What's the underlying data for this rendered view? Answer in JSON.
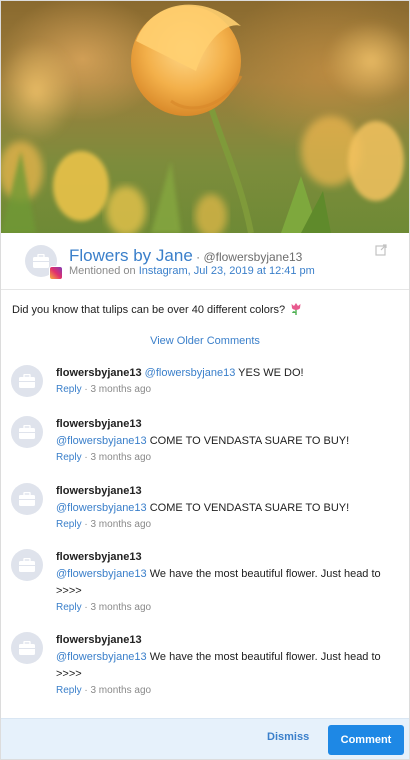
{
  "hero_image": {
    "subject": "tulip-photo",
    "colors": {
      "petal": "#f3b04a",
      "stem": "#7f9a3a"
    }
  },
  "post": {
    "page_name": "Flowers by Jane",
    "separator": " · ",
    "handle": "@flowersbyjane13",
    "mentioned_prefix": "Mentioned on ",
    "network": "Instagram",
    "date": ", Jul 23, 2019 at 12:41 pm",
    "text": "Did you know that tulips can be over 40 different colors?",
    "emoji_icon": "tulip-emoji"
  },
  "view_older_label": "View Older Comments",
  "comments": [
    {
      "user": "flowersbyjane13",
      "mention": "@flowersbyjane13",
      "text": " YES WE DO!",
      "reply": "Reply",
      "time": " · 3 months ago"
    },
    {
      "user": "flowersbyjane13",
      "mention": "@flowersbyjane13",
      "text": " COME TO VENDASTA SUARE TO BUY!",
      "reply": "Reply",
      "time": " · 3 months ago"
    },
    {
      "user": "flowersbyjane13",
      "mention": "@flowersbyjane13",
      "text": " COME TO VENDASTA SUARE TO BUY!",
      "reply": "Reply",
      "time": " · 3 months ago"
    },
    {
      "user": "flowersbyjane13",
      "mention": "@flowersbyjane13",
      "text": " We have the most beautiful flower. Just head to >>>>",
      "reply": "Reply",
      "time": " · 3 months ago"
    },
    {
      "user": "flowersbyjane13",
      "mention": "@flowersbyjane13",
      "text": " We have the most beautiful flower. Just head to >>>>",
      "reply": "Reply",
      "time": " · 3 months ago"
    }
  ],
  "footer": {
    "dismiss_label": "Dismiss",
    "comment_label": "Comment"
  },
  "colors": {
    "link": "#3a7fca",
    "primary_button": "#1e88e5",
    "footer_bg": "#e6f1fb"
  }
}
